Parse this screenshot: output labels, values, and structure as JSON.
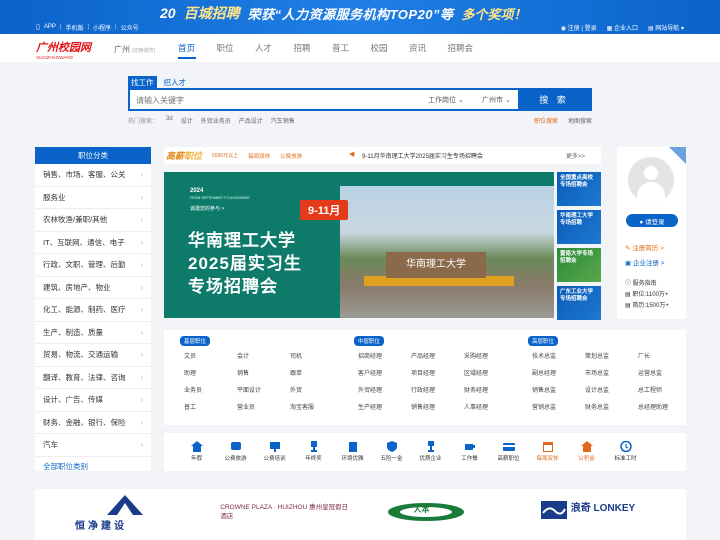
{
  "topbar": {
    "links": [
      "APP",
      "手机版",
      "小程序",
      "公众号"
    ],
    "promo": {
      "number": "20",
      "brand": "百城招聘",
      "message": "荣获“人力资源服务机构TOP20”等",
      "exclaim": "多个奖项！"
    },
    "register_login": "注册 | 登录",
    "enterprise": "企业入口",
    "site_nav": "网站导航"
  },
  "nav": {
    "logo_main": "广州校园网",
    "logo_sub": "XIAOZHAOWANG",
    "city": "广州",
    "city_switch": "[切换城市]",
    "menu": [
      "首页",
      "职位",
      "人才",
      "招聘",
      "普工",
      "校园",
      "资讯",
      "招聘会"
    ]
  },
  "search": {
    "tab_job": "找工作",
    "tab_talent": "招人才",
    "placeholder": "请输入关键字",
    "type_select": "工作岗位",
    "city_select": "广州市",
    "button": "搜 索",
    "hot_label": "热门搜索：",
    "hot_terms": [
      "3d",
      "设计",
      "外贸业务员",
      "产品设计",
      "汽车销售"
    ],
    "job_map": "职位搜索",
    "area_search": "地图搜索"
  },
  "categories": {
    "title": "职位分类",
    "items": [
      "销售、市场、客服、公关",
      "服务业",
      "农林牧渔/兼职/其他",
      "IT、互联网、通信、电子",
      "行政、文职、管理、后勤",
      "建筑、房地产、物业",
      "化工、能源、制药、医疗",
      "生产、制造、质量",
      "贸易、物流、交通运输",
      "翻译、教育、法律、咨询",
      "设计、广告、传媒",
      "财务、金融、银行、保险",
      "汽车"
    ],
    "all": "全部职位类别"
  },
  "news": {
    "gaoxin": "高薪",
    "gaoxin2": "职位",
    "tags": [
      "5000元以上",
      "每周双休",
      "公费旅游"
    ],
    "headline": "9-11月华南理工大学2025届实习生专场招聘会",
    "more": "更多>>"
  },
  "banner": {
    "year": "2024",
    "year_sub": "FROM SEPTEMBER TO NOVEMBER",
    "invite": "诚邀您的参与 >",
    "date": "9-11月",
    "line1": "华南理工大学",
    "line2": "2025届实习生",
    "line3": "专场招聘会",
    "stone_text": "华南理工大学"
  },
  "side_ads": [
    {
      "text": "全国重点高校专场招聘会"
    },
    {
      "text": "华南理工大学专场招聘"
    },
    {
      "text": "暨南大学专场招聘会"
    },
    {
      "text": "广东工业大学专场招聘会"
    }
  ],
  "user": {
    "login": "请登录",
    "register_resume": "注册简历 >",
    "register_company": "企业注册 >",
    "service_guide": "服务指南",
    "jobs_count": "职位:1100万+",
    "resume_count": "简历:1500万+"
  },
  "jobs": {
    "basic": {
      "title": "基层职位",
      "items": [
        "文员",
        "会计",
        "司机",
        "助理",
        "销售",
        "跟单",
        "业务员",
        "平面设计",
        "外贸",
        "普工",
        "营业员",
        "淘宝客服"
      ]
    },
    "middle": {
      "title": "中层职位",
      "items": [
        "招商经理",
        "产品经理",
        "采购经理",
        "客户经理",
        "项目经理",
        "区域经理",
        "外贸经理",
        "行政经理",
        "财务经理",
        "生产经理",
        "销售经理",
        "人事经理"
      ]
    },
    "senior": {
      "title": "高层职位",
      "items": [
        "技术总监",
        "策划总监",
        "厂长",
        "副总经理",
        "市场总监",
        "运营总监",
        "销售总监",
        "设计总监",
        "总工程师",
        "营销总监",
        "财务总监",
        "总经理助理"
      ]
    }
  },
  "tools": [
    "年假",
    "公费旅游",
    "公费培训",
    "年终奖",
    "环境优雅",
    "五险一金",
    "优质企业",
    "工作餐",
    "高薪职位",
    "每周双休",
    "公积金",
    "标准工时"
  ],
  "brands": [
    {
      "name": "恒净建设"
    },
    {
      "name": "CROWNE PLAZA · HUIZHOU 惠州皇冠假日酒店"
    },
    {
      "name": "人本"
    },
    {
      "name": "浪奇 LONKEY"
    }
  ],
  "colors": {
    "primary": "#0a63c9",
    "accent": "#e06a1a",
    "logo_red": "#e0151a",
    "banner_teal": "#0e7a6a"
  }
}
